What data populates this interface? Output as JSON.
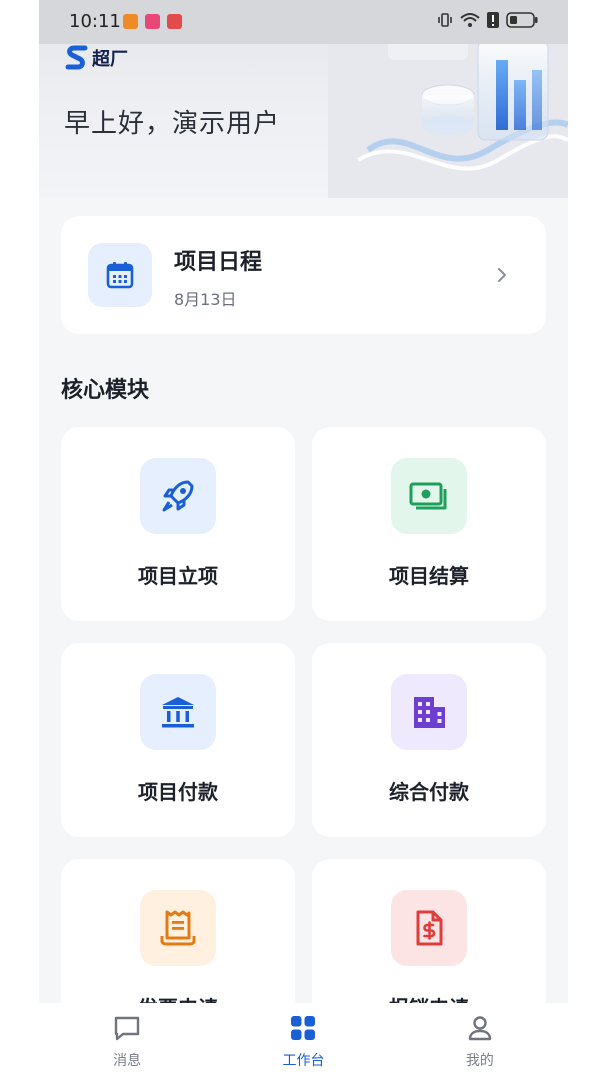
{
  "status_bar": {
    "time": "10:11",
    "notification_colors": [
      "#f08a24",
      "#e9467a",
      "#e24b4b"
    ]
  },
  "header": {
    "logo_text": "超厂",
    "greeting": "早上好，演示用户"
  },
  "schedule": {
    "title": "项目日程",
    "date": "8月13日"
  },
  "core_modules": {
    "title": "核心模块",
    "items": [
      {
        "label": "项目立项",
        "icon": "rocket-icon",
        "bg": "#e5effd",
        "color": "#1a5fd6"
      },
      {
        "label": "项目结算",
        "icon": "money-icon",
        "bg": "#e2f6ec",
        "color": "#1e9e5c"
      },
      {
        "label": "项目付款",
        "icon": "bank-icon",
        "bg": "#e5effd",
        "color": "#1a5fd6"
      },
      {
        "label": "综合付款",
        "icon": "building-icon",
        "bg": "#efe9fd",
        "color": "#6d3fd1"
      },
      {
        "label": "发票申请",
        "icon": "receipt-icon",
        "bg": "#fff0df",
        "color": "#e07b17"
      },
      {
        "label": "报销申请",
        "icon": "invoice-dollar-icon",
        "bg": "#fde4e4",
        "color": "#e03c3c"
      }
    ]
  },
  "bottom_nav": {
    "items": [
      {
        "label": "消息",
        "icon": "message-icon",
        "active": false
      },
      {
        "label": "工作台",
        "icon": "workbench-icon",
        "active": true
      },
      {
        "label": "我的",
        "icon": "profile-icon",
        "active": false
      }
    ]
  },
  "colors": {
    "accent": "#1a5fd6",
    "background": "#f5f6f8",
    "card": "#ffffff"
  }
}
